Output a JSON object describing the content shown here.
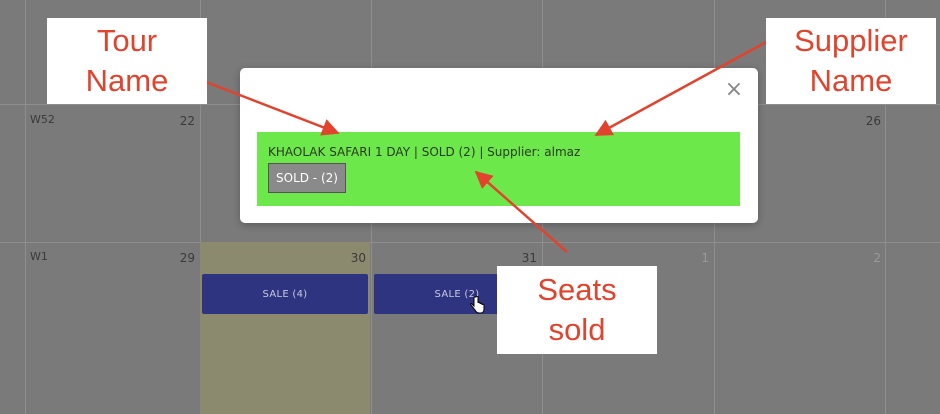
{
  "calendar": {
    "weeks": [
      {
        "label": "W52",
        "days": [
          "22",
          "26"
        ]
      },
      {
        "label": "W1",
        "days": [
          "29",
          "30",
          "31",
          "1",
          "2"
        ]
      }
    ],
    "events": [
      {
        "label": "SALE (4)"
      },
      {
        "label": "SALE (2)"
      }
    ],
    "highlight_color": "#8b8a6e",
    "event_color": "#2e3480"
  },
  "modal": {
    "booking_text": "KHAOLAK SAFARI 1 DAY | SOLD (2) | Supplier: almaz",
    "sold_button_label": "SOLD - (2)",
    "close_icon": "×",
    "booking_color": "#6de84a"
  },
  "annotations": {
    "tour_name": [
      "Tour",
      "Name"
    ],
    "supplier_name": [
      "Supplier",
      "Name"
    ],
    "seats_sold": [
      "Seats",
      "sold"
    ],
    "arrow_color": "#e2432d"
  }
}
